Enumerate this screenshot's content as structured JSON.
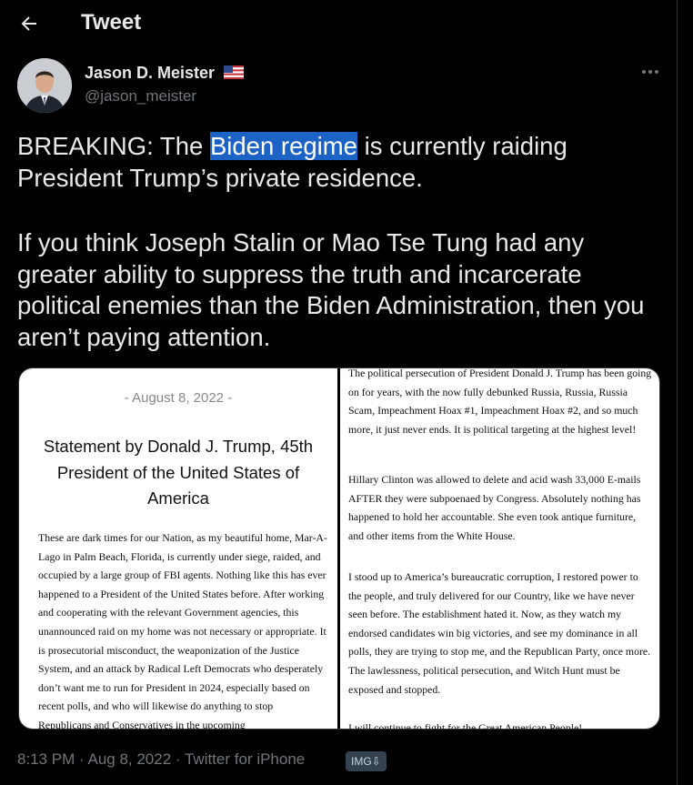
{
  "header": {
    "title": "Tweet"
  },
  "author": {
    "name": "Jason D. Meister",
    "handle": "@jason_meister",
    "flag_icon": "us-flag-icon"
  },
  "tweet": {
    "p1_before": "BREAKING: The ",
    "p1_highlight": "Biden regime",
    "p1_after": " is currently raiding President Trump’s private residence.",
    "p2": "If you think Joseph Stalin or Mao Tse Tung had any greater ability to suppress the truth and incarcerate political enemies than the Biden Administration, then you aren’t paying attention."
  },
  "media": {
    "left_page": {
      "date": "- August 8, 2022 -",
      "title": "Statement by Donald J. Trump, 45th President of the United States of America",
      "body": "These are dark times for our Nation, as my beautiful home, Mar-A-Lago in Palm Beach, Florida, is currently under siege, raided, and occupied by a large group of FBI agents. Nothing like this has ever happened to a President of the United States before. After working and cooperating with the relevant Government agencies, this unannounced raid on my home was not necessary or appropriate. It is prosecutorial misconduct, the weaponization of the Justice System, and an attack by Radical Left Democrats who desperately don’t want me to run for President in 2024, especially based on recent polls, and who will likewise do anything to stop Republicans and Conservatives in the upcoming"
    },
    "right_page": {
      "para0": "The political persecution of President Donald J. Trump has been going on for years, with the now fully debunked Russia, Russia, Russia Scam, Impeachment Hoax #1, Impeachment Hoax #2, and so much more, it just never ends. It is political targeting at the highest level!",
      "para1": "Hillary Clinton was allowed to delete and acid wash 33,000 E-mails AFTER they were subpoenaed by Congress. Absolutely nothing has happened to hold her accountable. She even took antique furniture, and other items from the White House.",
      "para2": "I stood up to America’s bureaucratic corruption, I restored power to the people, and truly delivered for our Country, like we have never seen before. The establishment hated it. Now, as they watch my endorsed candidates win big victories, and see my dominance in all polls, they are trying to stop me, and the Republican Party, once more. The lawlessness, political persecution, and Witch Hunt must be exposed and stopped.",
      "para3": "I will continue to fight for the Great American People!"
    }
  },
  "meta": {
    "text": "8:13 PM · Aug 8, 2022 · Twitter for iPhone",
    "badge": "IMG⇩"
  },
  "colors": {
    "background": "#000000",
    "text": "#e7e9ea",
    "secondary_text": "#71767b",
    "selection_highlight": "#1d63c6"
  }
}
